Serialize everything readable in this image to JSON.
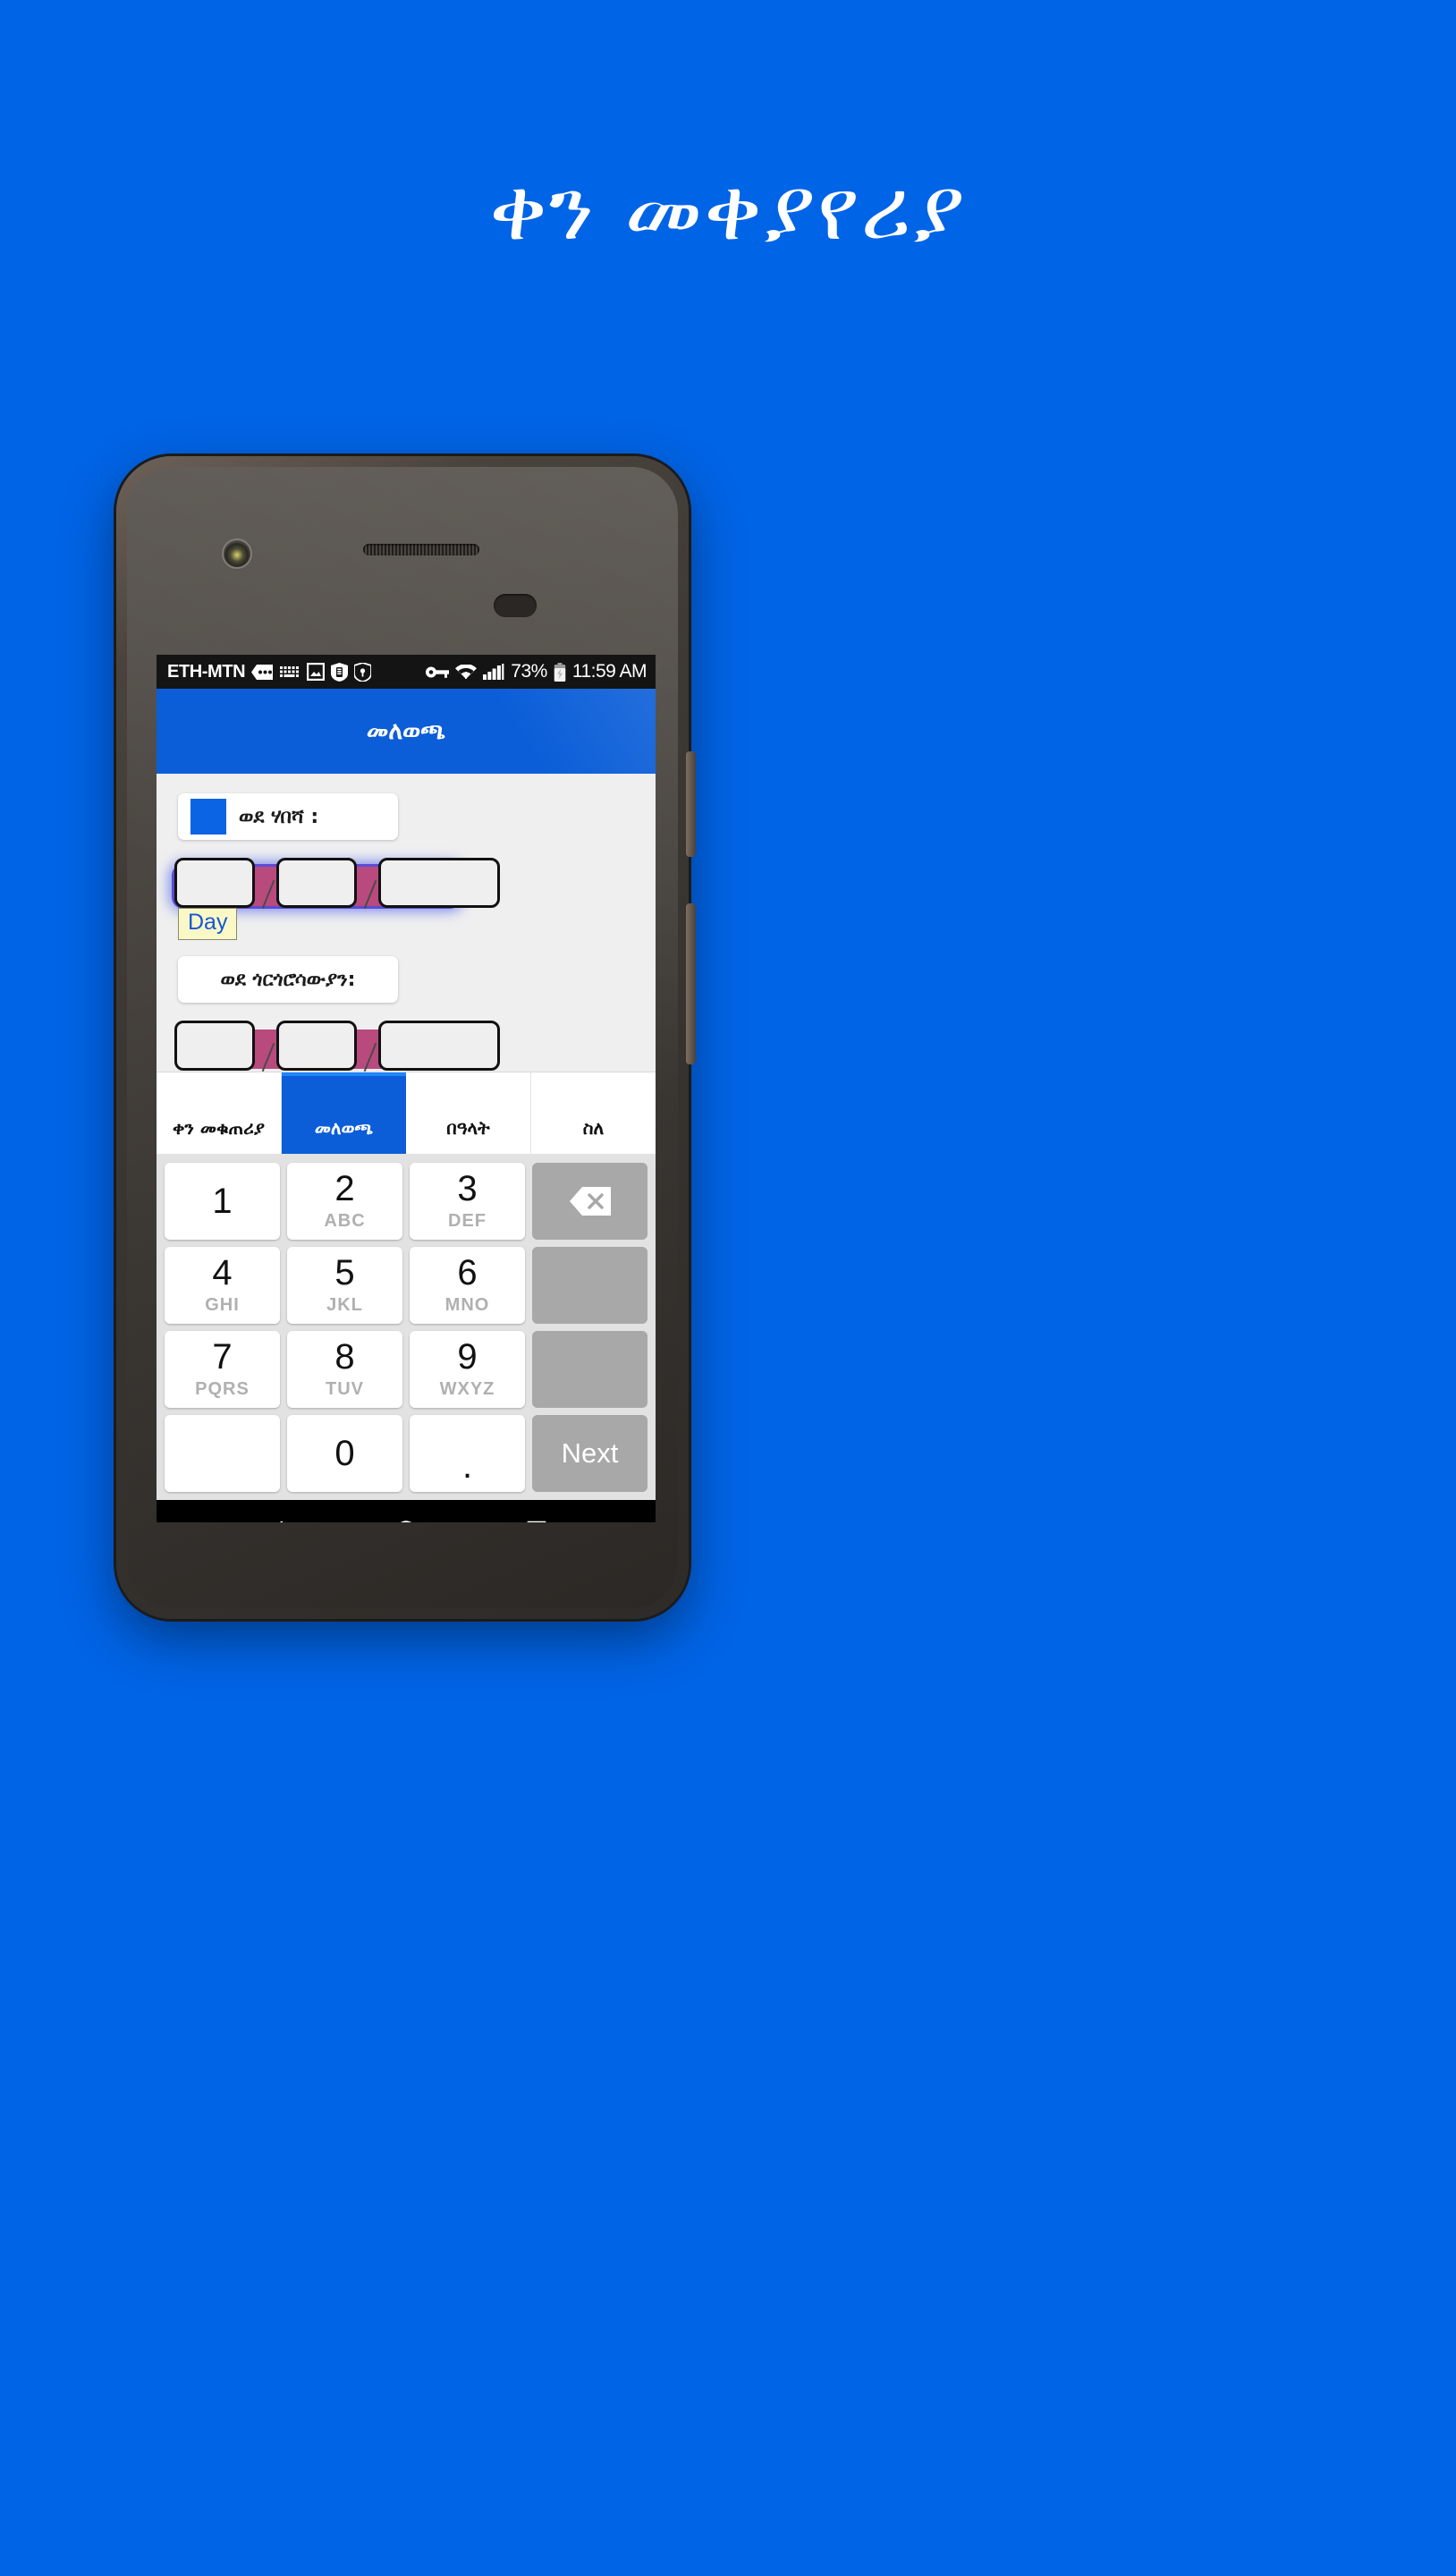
{
  "promo": {
    "title": "ቀን መቀያየሪያ",
    "background_color": "#0064e6"
  },
  "status_bar": {
    "carrier": "ETH-MTN",
    "battery_percent": "73%",
    "clock": "11:59 AM",
    "icons": [
      "sim-dots-icon",
      "keyboard-icon",
      "image-icon",
      "battery-shield-icon",
      "shield-key-icon",
      "vpn-key-icon",
      "wifi-icon",
      "signal-bars-icon",
      "battery-charging-icon"
    ]
  },
  "app_bar": {
    "title": "መለወጫ",
    "background_color": "#0b5ed8"
  },
  "form": {
    "to_habesha": {
      "label": "ወደ ሃበሻ :",
      "swatch_color": "#0b64e3",
      "boxes": [
        "",
        "",
        ""
      ],
      "separator": "/",
      "tooltip": "Day",
      "underline_color": "#b94a7e",
      "focus_glow_color": "#5a4bd6"
    },
    "to_gregorian": {
      "label": "ወደ ጎርጎሮሳውያን:",
      "boxes": [
        "",
        "",
        ""
      ],
      "separator": "/",
      "underline_color": "#b94a7e"
    }
  },
  "tabs": [
    {
      "label": "ቀን መቁጠሪያ",
      "active": false
    },
    {
      "label": "መለወጫ",
      "active": true
    },
    {
      "label": "በዓላት",
      "active": false
    },
    {
      "label": "ስለ",
      "active": false
    }
  ],
  "keypad": {
    "rows": [
      [
        {
          "digit": "1",
          "letters": "",
          "style": "white"
        },
        {
          "digit": "2",
          "letters": "ABC",
          "style": "white"
        },
        {
          "digit": "3",
          "letters": "DEF",
          "style": "white"
        },
        {
          "digit": "",
          "letters": "",
          "style": "grey",
          "icon": "backspace-icon"
        }
      ],
      [
        {
          "digit": "4",
          "letters": "GHI",
          "style": "white"
        },
        {
          "digit": "5",
          "letters": "JKL",
          "style": "white"
        },
        {
          "digit": "6",
          "letters": "MNO",
          "style": "white"
        },
        {
          "digit": "",
          "letters": "",
          "style": "grey"
        }
      ],
      [
        {
          "digit": "7",
          "letters": "PQRS",
          "style": "white"
        },
        {
          "digit": "8",
          "letters": "TUV",
          "style": "white"
        },
        {
          "digit": "9",
          "letters": "WXYZ",
          "style": "white"
        },
        {
          "digit": "",
          "letters": "",
          "style": "grey"
        }
      ],
      [
        {
          "digit": "",
          "letters": "",
          "style": "white"
        },
        {
          "digit": "0",
          "letters": "",
          "style": "white"
        },
        {
          "digit": ".",
          "letters": "",
          "style": "white"
        },
        {
          "digit": "",
          "letters": "",
          "style": "grey",
          "label": "Next"
        }
      ]
    ]
  },
  "nav_bar": {
    "back": "back-triangle-icon",
    "home": "home-circle-icon",
    "recents": "recents-square-icon"
  }
}
